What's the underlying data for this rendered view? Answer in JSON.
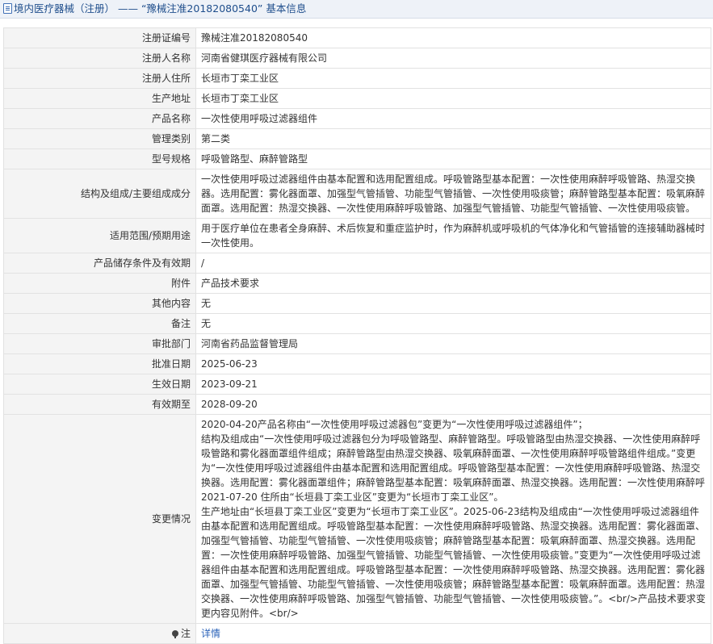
{
  "header": {
    "title": "境内医疗器械（注册） —— “豫械注准20182080540” 基本信息"
  },
  "rows": [
    {
      "label": "注册证编号",
      "value": "豫械注准20182080540"
    },
    {
      "label": "注册人名称",
      "value": "河南省健琪医疗器械有限公司"
    },
    {
      "label": "注册人住所",
      "value": "长垣市丁栾工业区"
    },
    {
      "label": "生产地址",
      "value": "长垣市丁栾工业区"
    },
    {
      "label": "产品名称",
      "value": "一次性使用呼吸过滤器组件"
    },
    {
      "label": "管理类别",
      "value": "第二类"
    },
    {
      "label": "型号规格",
      "value": "呼吸管路型、麻醉管路型"
    },
    {
      "label": "结构及组成/主要组成成分",
      "value": "一次性使用呼吸过滤器组件由基本配置和选用配置组成。呼吸管路型基本配置：一次性使用麻醉呼吸管路、热湿交换器。选用配置：雾化器面罩、加强型气管插管、功能型气管插管、一次性使用吸痰管；麻醉管路型基本配置：吸氧麻醉面罩。选用配置：热湿交换器、一次性使用麻醉呼吸管路、加强型气管插管、功能型气管插管、一次性使用吸痰管。"
    },
    {
      "label": "适用范围/预期用途",
      "value": "用于医疗单位在患者全身麻醉、术后恢复和重症监护时，作为麻醉机或呼吸机的气体净化和气管插管的连接辅助器械时一次性使用。"
    },
    {
      "label": "产品储存条件及有效期",
      "value": "/"
    },
    {
      "label": "附件",
      "value": "产品技术要求"
    },
    {
      "label": "其他内容",
      "value": "无"
    },
    {
      "label": "备注",
      "value": "无"
    },
    {
      "label": "审批部门",
      "value": "河南省药品监督管理局"
    },
    {
      "label": "批准日期",
      "value": "2025-06-23"
    },
    {
      "label": "生效日期",
      "value": "2023-09-21"
    },
    {
      "label": "有效期至",
      "value": "2028-09-20"
    }
  ],
  "change": {
    "label": "变更情况",
    "value": "2020-04-20产品名称由“一次性使用呼吸过滤器包”变更为“一次性使用呼吸过滤器组件”；\n结构及组成由“一次性使用呼吸过滤器包分为呼吸管路型、麻醉管路型。呼吸管路型由热湿交换器、一次性使用麻醉呼吸管路和雾化器面罩组件组成；麻醉管路型由热湿交换器、吸氧麻醉面罩、一次性使用麻醉呼吸管路组件组成。”变更为“一次性使用呼吸过滤器组件由基本配置和选用配置组成。呼吸管路型基本配置：一次性使用麻醉呼吸管路、热湿交换器。选用配置：雾化器面罩组件；麻醉管路型基本配置：吸氧麻醉面罩、热湿交换器。选用配置：一次性使用麻醉呼\n2021-07-20 住所由“长垣县丁栾工业区”变更为“长垣市丁栾工业区”。\n生产地址由“长垣县丁栾工业区”变更为“长垣市丁栾工业区”。2025-06-23结构及组成由“一次性使用呼吸过滤器组件由基本配置和选用配置组成。呼吸管路型基本配置：一次性使用麻醉呼吸管路、热湿交换器。选用配置：雾化器面罩、加强型气管插管、功能型气管插管、一次性使用吸痰管；麻醉管路型基本配置：吸氧麻醉面罩、热湿交换器。选用配置：一次性使用麻醉呼吸管路、加强型气管插管、功能型气管插管、一次性使用吸痰管。”变更为“一次性使用呼吸过滤器组件由基本配置和选用配置组成。呼吸管路型基本配置：一次性使用麻醉呼吸管路、热湿交换器。选用配置：雾化器面罩、加强型气管插管、功能型气管插管、一次性使用吸痰管；麻醉管路型基本配置：吸氧麻醉面罩。选用配置：热湿交换器、一次性使用麻醉呼吸管路、加强型气管插管、功能型气管插管、一次性使用吸痰管。”。<br/>产品技术要求变更内容见附件。<br/>"
  },
  "note": {
    "label": "注",
    "link": "详情"
  },
  "colors": {
    "header_bg": "#eef2f8",
    "header_text": "#1f4e8c",
    "label_bg": "#f4f4f4",
    "border": "#e2e2e2",
    "link": "#2a62b8"
  }
}
